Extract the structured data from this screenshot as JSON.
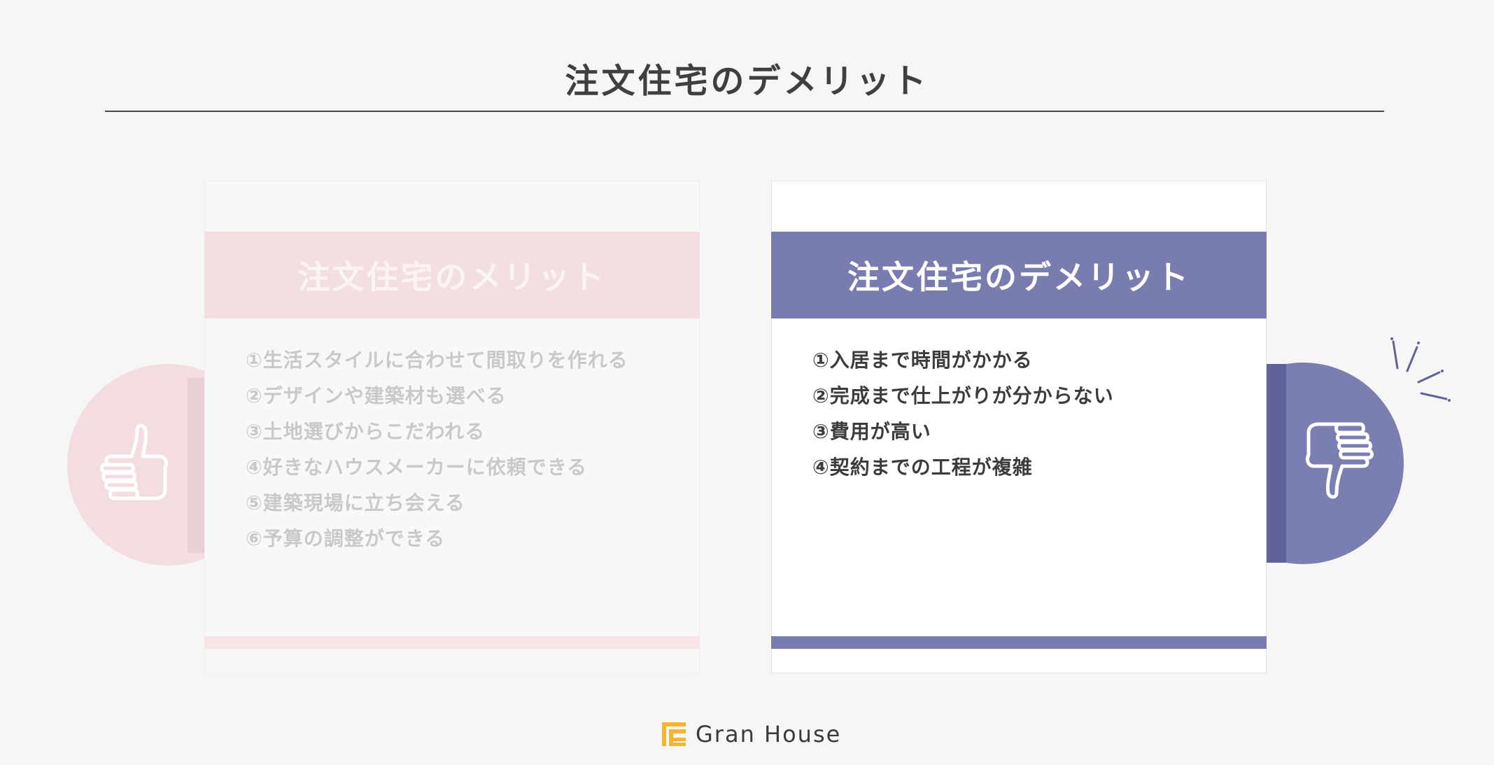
{
  "page": {
    "title": "注文住宅のデメリット"
  },
  "merit_card": {
    "title": "注文住宅のメリット",
    "items": [
      "①生活スタイルに合わせて間取りを作れる",
      "②デザインや建築材も選べる",
      "③土地選びからこだわれる",
      "④好きなハウスメーカーに依頼できる",
      "⑤建築現場に立ち会える",
      "⑥予算の調整ができる"
    ],
    "icon": "thumbs-up-icon",
    "accent_color": "#f3dfe1"
  },
  "demerit_card": {
    "title": "注文住宅のデメリット",
    "items": [
      "①入居まで時間がかかる",
      "②完成まで仕上がりが分からない",
      "③費用が高い",
      "④契約までの工程が複雑"
    ],
    "icon": "thumbs-down-icon",
    "accent_color": "#787cae"
  },
  "brand": {
    "name": "Gran House",
    "logo_color": "#f2b731"
  }
}
